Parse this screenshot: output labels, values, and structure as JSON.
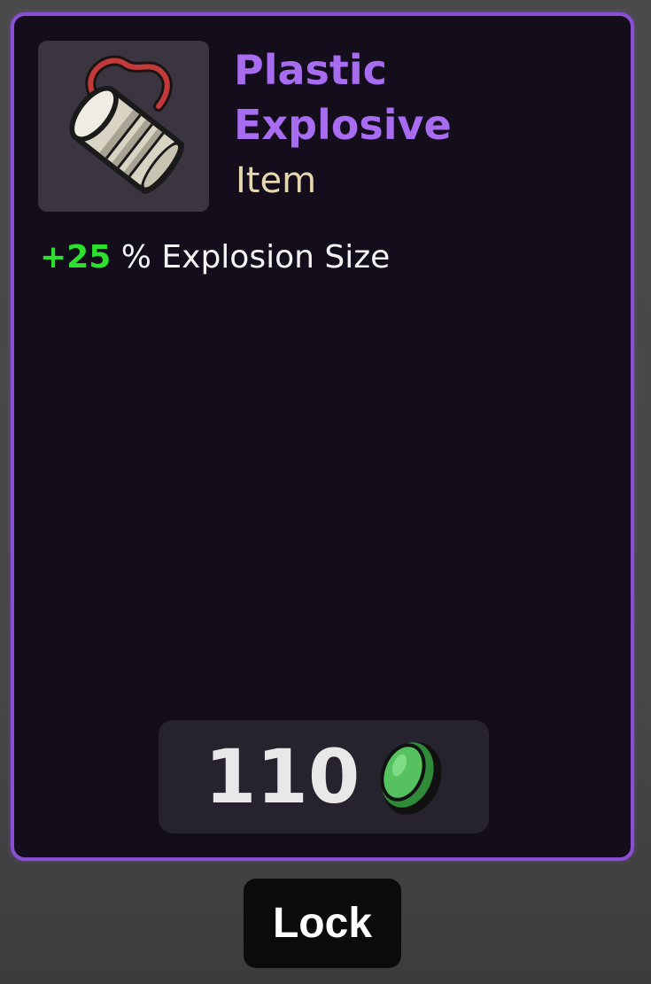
{
  "item": {
    "name": "Plastic Explosive",
    "type": "Item",
    "rarity_color": "#8b4fd6",
    "icon": "plastic-explosive-icon"
  },
  "stats": [
    {
      "value": "+25",
      "unit": "%",
      "label": "Explosion Size",
      "value_color": "#2ee02e"
    }
  ],
  "price": {
    "amount": "110",
    "currency_icon": "material-coin-icon",
    "currency_color": "#4cc85a"
  },
  "actions": {
    "lock_label": "Lock"
  }
}
